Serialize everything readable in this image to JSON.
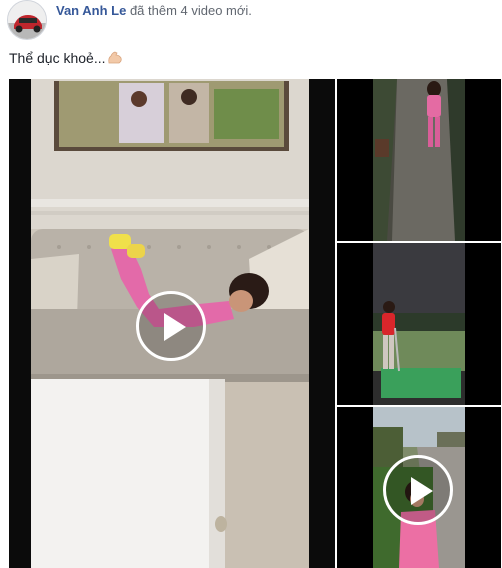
{
  "post": {
    "author": "Van Anh Le",
    "action": "đã thêm 4 video mới.",
    "caption": "Thể dục khoẻ..."
  },
  "icons": {
    "avatar": "profile-avatar-red-car",
    "caption_emoji": "flexed-biceps-icon",
    "play": "play-icon"
  },
  "colors": {
    "author_link": "#365899",
    "text": "#1d2129",
    "muted": "#616770"
  }
}
